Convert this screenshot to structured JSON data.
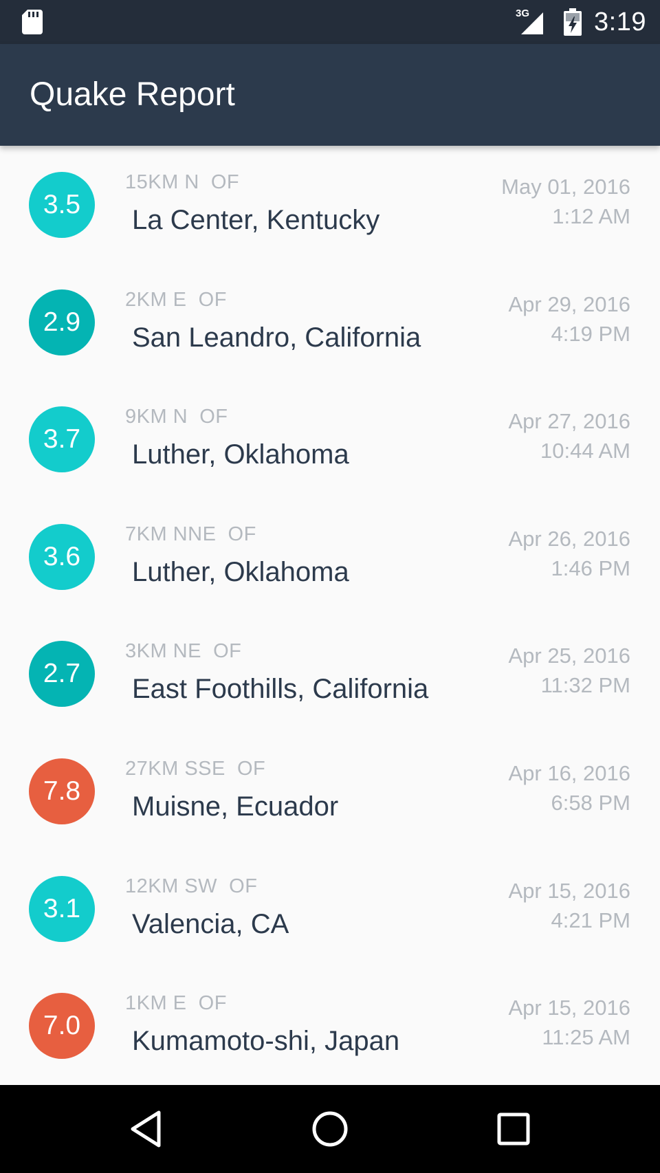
{
  "status_bar": {
    "network": "3G",
    "time": "3:19",
    "icons": [
      "sd-card-icon",
      "signal-icon",
      "battery-charging-icon"
    ]
  },
  "app_bar": {
    "title": "Quake Report",
    "color": "#2c3a4c"
  },
  "earthquakes": [
    {
      "magnitude": "3.5",
      "offset": "15KM N  OF",
      "place": "La Center, Kentucky",
      "date": "May 01, 2016",
      "time": "1:12 AM",
      "color": "#13cccc"
    },
    {
      "magnitude": "2.9",
      "offset": "2KM E  OF",
      "place": "San Leandro, California",
      "date": "Apr 29, 2016",
      "time": "4:19 PM",
      "color": "#04b4b3"
    },
    {
      "magnitude": "3.7",
      "offset": "9KM N  OF",
      "place": "Luther, Oklahoma",
      "date": "Apr 27, 2016",
      "time": "10:44 AM",
      "color": "#13cccc"
    },
    {
      "magnitude": "3.6",
      "offset": "7KM NNE  OF",
      "place": "Luther, Oklahoma",
      "date": "Apr 26, 2016",
      "time": "1:46 PM",
      "color": "#13cccc"
    },
    {
      "magnitude": "2.7",
      "offset": "3KM NE  OF",
      "place": "East Foothills, California",
      "date": "Apr 25, 2016",
      "time": "11:32 PM",
      "color": "#04b4b3"
    },
    {
      "magnitude": "7.8",
      "offset": "27KM SSE  OF",
      "place": "Muisne, Ecuador",
      "date": "Apr 16, 2016",
      "time": "6:58 PM",
      "color": "#e75f40"
    },
    {
      "magnitude": "3.1",
      "offset": "12KM SW  OF",
      "place": "Valencia, CA",
      "date": "Apr 15, 2016",
      "time": "4:21 PM",
      "color": "#13cccc"
    },
    {
      "magnitude": "7.0",
      "offset": "1KM E  OF",
      "place": "Kumamoto-shi, Japan",
      "date": "Apr 15, 2016",
      "time": "11:25 AM",
      "color": "#e75f40"
    }
  ],
  "nav_bar": {
    "buttons": [
      "back-icon",
      "home-icon",
      "recents-icon"
    ]
  }
}
